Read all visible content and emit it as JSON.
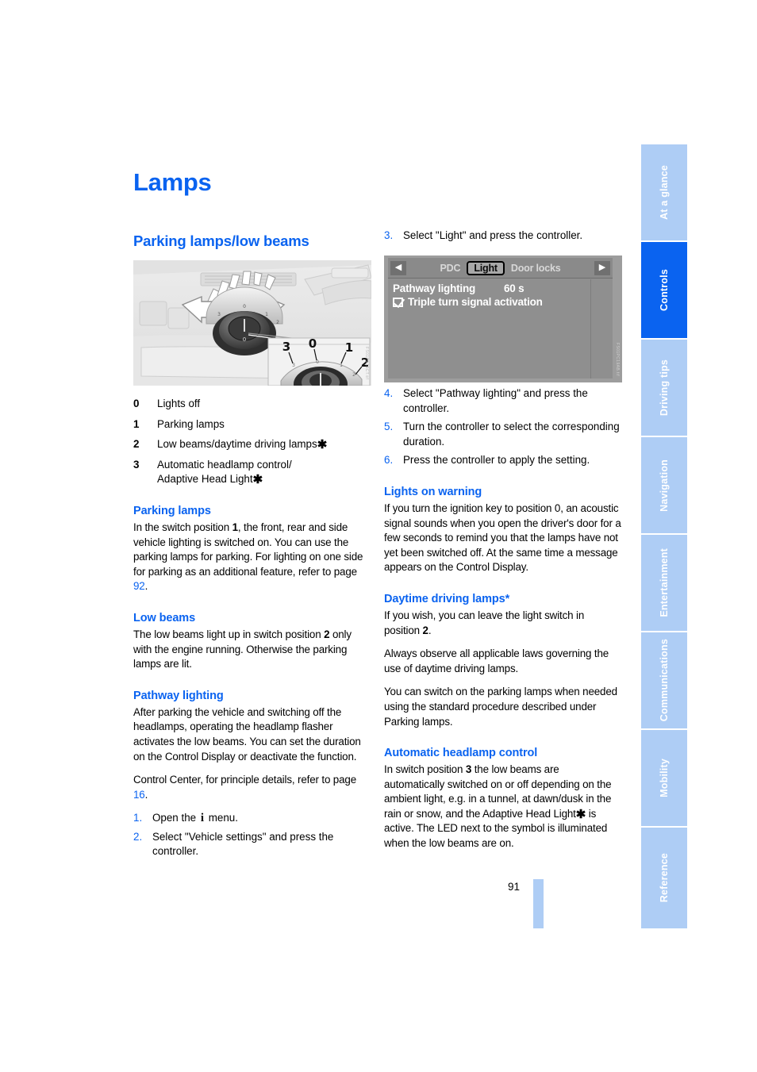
{
  "page": {
    "title": "Lamps",
    "number": "91"
  },
  "sidebar": {
    "tabs": [
      {
        "label": "At a glance",
        "active": false
      },
      {
        "label": "Controls",
        "active": true
      },
      {
        "label": "Driving tips",
        "active": false
      },
      {
        "label": "Navigation",
        "active": false
      },
      {
        "label": "Entertainment",
        "active": false
      },
      {
        "label": "Communications",
        "active": false
      },
      {
        "label": "Mobility",
        "active": false
      },
      {
        "label": "Reference",
        "active": false
      }
    ],
    "active_color": "#0a63f0",
    "inactive_color": "#aecdf5"
  },
  "left_column": {
    "section_heading": "Parking lamps/low beams",
    "figure": {
      "name": "light-switch-illustration",
      "detail_labels": [
        "3",
        "0",
        "1",
        "2"
      ],
      "watermark": "FS01PC19CT.tif"
    },
    "switch_positions": [
      {
        "key": "0",
        "label": "Lights off",
        "asterisk": false
      },
      {
        "key": "1",
        "label": "Parking lamps",
        "asterisk": false
      },
      {
        "key": "2",
        "label": "Low beams/daytime driving lamps",
        "asterisk": true
      },
      {
        "key": "3",
        "label": "Automatic headlamp control/\nAdaptive Head Light",
        "asterisk": true
      }
    ],
    "parking_lamps": {
      "heading": "Parking lamps",
      "text_1": "In the switch position ",
      "bold_1": "1",
      "text_2": ", the front, rear and side vehicle lighting is switched on. You can use the parking lamps for parking. For lighting on one side for parking as an additional feature, refer to page ",
      "page_ref": "92",
      "text_3": "."
    },
    "low_beams": {
      "heading": "Low beams",
      "text_1": "The low beams light up in switch position ",
      "bold_1": "2",
      "text_2": " only with the engine running. Otherwise the parking lamps are lit."
    },
    "pathway_lighting": {
      "heading": "Pathway lighting",
      "para_1": "After parking the vehicle and switching off the headlamps, operating the headlamp flasher activates the low beams. You can set the duration on the Control Display or deactivate the function.",
      "para_2_text_1": "Control Center, for principle details, refer to page ",
      "para_2_page_ref": "16",
      "para_2_text_2": ".",
      "steps": [
        {
          "n": "1.",
          "text_before": "Open the ",
          "icon": "i",
          "text_after": " menu."
        },
        {
          "n": "2.",
          "text_before": "Select \"Vehicle settings\" and press the controller.",
          "icon": "",
          "text_after": ""
        }
      ]
    }
  },
  "right_column": {
    "step_3": {
      "n": "3.",
      "text": "Select \"Light\" and press the controller."
    },
    "control_display": {
      "name": "control-display-screenshot",
      "left_arrow": "◀",
      "right_arrow": "▶",
      "tabs": [
        {
          "label": "PDC",
          "selected": false
        },
        {
          "label": "Light",
          "selected": true
        },
        {
          "label": "Door locks",
          "selected": false
        }
      ],
      "rows": [
        {
          "label": "Pathway lighting",
          "value": "60 s",
          "checkbox": false
        },
        {
          "label": "Triple turn signal activation",
          "value": "",
          "checkbox": true
        }
      ],
      "watermark": "FS01PC19AB.tif"
    },
    "steps": [
      {
        "n": "4.",
        "text": "Select \"Pathway lighting\" and press the controller."
      },
      {
        "n": "5.",
        "text": "Turn the controller to select the corresponding duration."
      },
      {
        "n": "6.",
        "text": "Press the controller to apply the setting."
      }
    ],
    "lights_on_warning": {
      "heading": "Lights on warning",
      "text": "If you turn the ignition key to position 0, an acoustic signal sounds when you open the driver's door for a few seconds to remind you that the lamps have not yet been switched off. At the same time a message appears on the Control Display."
    },
    "daytime_driving_lamps": {
      "heading": "Daytime driving lamps*",
      "para_1_text_1": "If you wish, you can leave the light switch in position ",
      "para_1_bold": "2",
      "para_1_text_2": ".",
      "para_2": "Always observe all applicable laws governing the use of daytime driving lamps.",
      "para_3": "You can switch on the parking lamps when needed using the standard procedure described under Parking lamps."
    },
    "automatic_headlamp_control": {
      "heading": "Automatic headlamp control",
      "text_1": "In switch position ",
      "bold_1": "3",
      "text_2": " the low beams are automatically switched on or off depending on the ambient light, e.g. in a tunnel, at dawn/dusk in the rain or snow, and the Adaptive Head Light",
      "asterisk": "*",
      "text_3": " is active. The LED next to the symbol is illuminated when the low beams are on."
    }
  }
}
